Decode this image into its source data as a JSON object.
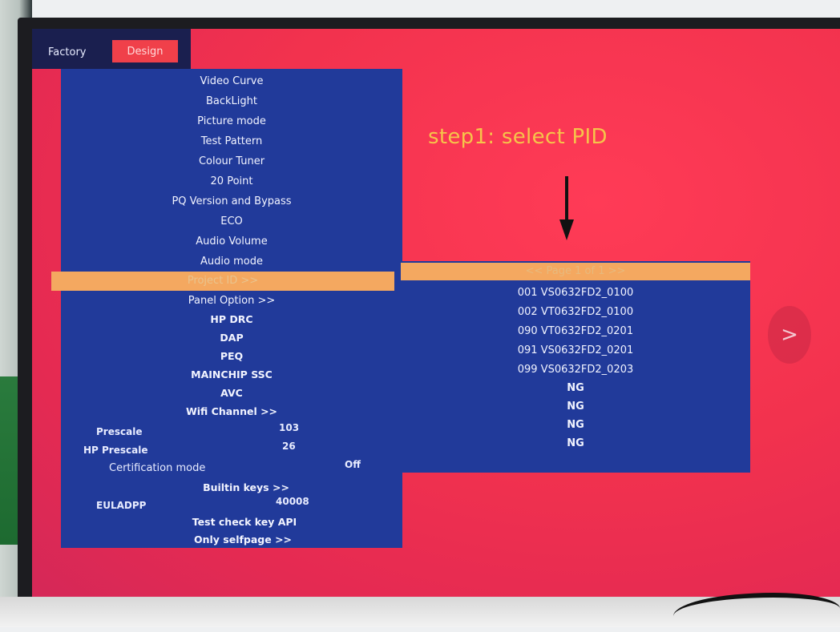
{
  "tabs": {
    "factory": "Factory",
    "design": "Design"
  },
  "menu": {
    "items": [
      "Video Curve",
      "BackLight",
      "Picture mode",
      "Test Pattern",
      "Colour Tuner",
      "20 Point",
      "PQ Version and Bypass",
      "ECO",
      "Audio Volume",
      "Audio mode",
      "Project ID >>",
      "Panel Option >>",
      "HP DRC",
      "DAP",
      "PEQ",
      "MAINCHIP SSC",
      "AVC",
      "Wifi Channel >>"
    ],
    "selected_index": 10,
    "prescale": {
      "label": "Prescale",
      "value": "103"
    },
    "hp_prescale": {
      "label": "HP Prescale",
      "value": "26"
    },
    "certification": {
      "label": "Certification mode",
      "value": "Off"
    },
    "builtin_keys": "Builtin keys >>",
    "euladpp": {
      "label": "EULADPP",
      "value": "40008"
    },
    "test_check_key": "Test check key API",
    "only_selfpage": "Only selfpage >>"
  },
  "annotation": {
    "step": "step1: select PID"
  },
  "pid_list": {
    "header": "<< Page 1 of 1 >>",
    "items": [
      "001 VS0632FD2_0100",
      "002 VT0632FD2_0100",
      "090 VT0632FD2_0201",
      "091 VS0632FD2_0201",
      "099 VS0632FD2_0203",
      "NG",
      "NG",
      "NG",
      "NG"
    ]
  },
  "next_button": ">",
  "colors": {
    "screen_bg": "#f2324e",
    "menu_bg": "#213a9a",
    "highlight": "#f4a860",
    "annotation": "#f6c44a"
  },
  "icons": {
    "arrow": "arrow-down-icon",
    "next": "chevron-right-icon"
  }
}
